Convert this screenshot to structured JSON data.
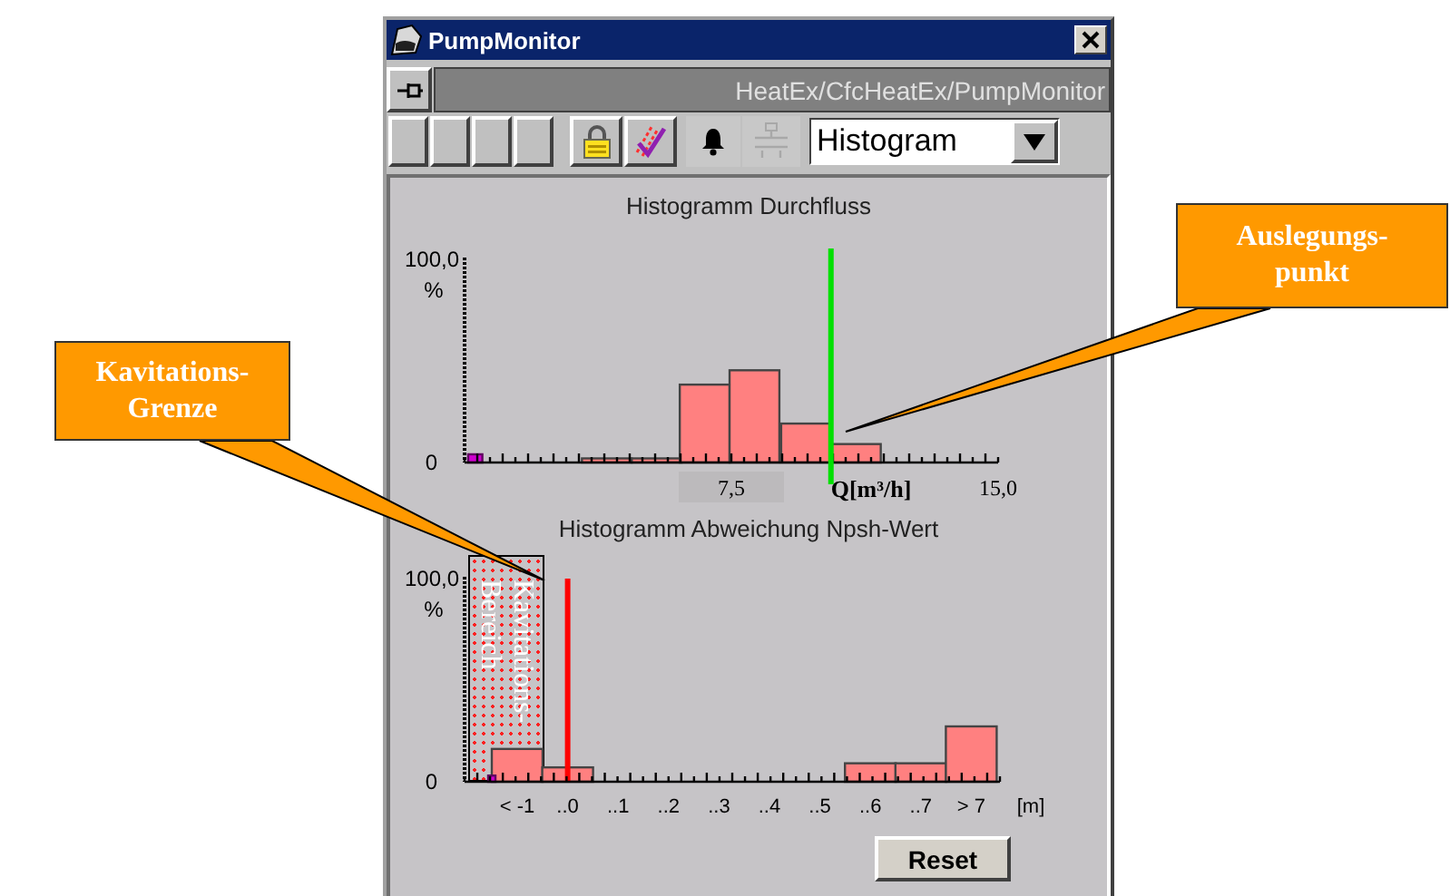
{
  "window": {
    "title": "PumpMonitor"
  },
  "path_bar": {
    "path": "HeatEx/CfcHeatEx/PumpMonitor"
  },
  "toolbar": {
    "buttons": [
      {
        "kind": "blank",
        "disabled": false
      },
      {
        "kind": "blank",
        "disabled": false
      },
      {
        "kind": "blank",
        "disabled": false
      },
      {
        "kind": "blank",
        "disabled": false
      },
      {
        "kind": "lock",
        "disabled": false
      },
      {
        "kind": "trend",
        "disabled": false
      },
      {
        "kind": "bell",
        "disabled": false
      },
      {
        "kind": "pipe",
        "disabled": true
      }
    ],
    "view_select": {
      "value": "Histogram"
    }
  },
  "flow_histogram": {
    "title": "Histogramm Durchfluss",
    "chart_data": {
      "type": "bar",
      "xlabel": "Q[m³/h]",
      "ylabel": "%",
      "x": [
        0.3,
        4.0,
        5.4,
        6.75,
        8.15,
        9.6,
        11.0
      ],
      "series": [
        {
          "color": "#ff8080",
          "values": [
            null,
            2,
            2,
            38,
            45,
            19,
            9
          ]
        },
        {
          "color": "#d000d0",
          "values": [
            4,
            null,
            null,
            null,
            null,
            null,
            null
          ]
        }
      ],
      "xlim": [
        0,
        15
      ],
      "ylim": [
        0,
        100
      ],
      "xticks": [
        {
          "value": 7.5,
          "label": "7,5"
        },
        {
          "value": 15,
          "label": "15,0"
        }
      ],
      "yticks": [
        {
          "value": 0,
          "label": "0"
        },
        {
          "value": 100,
          "label": "100,0"
        }
      ],
      "ref_lines": [
        {
          "axis": "x",
          "value": 10.3,
          "color": "#00e000"
        }
      ]
    }
  },
  "npsh_histogram": {
    "title": "Histogramm Abweichung Npsh-Wert",
    "chart_data": {
      "type": "bar",
      "xlabel": "[m]",
      "ylabel": "%",
      "categories": [
        "< -1",
        "..0",
        "..1",
        "..2",
        "..3",
        "..4",
        "..5",
        "..6",
        "..7",
        "> 7"
      ],
      "series": [
        {
          "color": "#ff8080",
          "values": [
            16,
            7,
            0,
            0,
            0,
            0,
            0,
            9,
            9,
            27
          ]
        },
        {
          "color": "#d000d0",
          "values": [
            3,
            null,
            null,
            null,
            null,
            null,
            null,
            null,
            null,
            null
          ]
        }
      ],
      "ylim": [
        0,
        100
      ],
      "yticks": [
        {
          "value": 0,
          "label": "0"
        },
        {
          "value": 100,
          "label": "100,0"
        }
      ],
      "ref_lines": [
        {
          "axis": "x",
          "value": "..0",
          "color": "#ff0000"
        }
      ]
    },
    "cavitation_zone": {
      "lines": [
        "Kavitations-",
        "Bereich"
      ]
    }
  },
  "reset_button": {
    "label": "Reset"
  },
  "callouts": [
    {
      "lines": [
        "Auslegungs-",
        "punkt"
      ]
    },
    {
      "lines": [
        "Kavitations-",
        "Grenze"
      ]
    }
  ]
}
